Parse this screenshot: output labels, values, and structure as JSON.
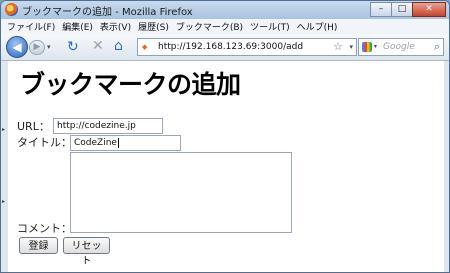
{
  "window": {
    "title": "ブックマークの追加 - Mozilla Firefox",
    "controls": {
      "minimize": "–",
      "maximize": "□",
      "close": "✕"
    }
  },
  "menubar": {
    "items": [
      "ファイル(F)",
      "編集(E)",
      "表示(V)",
      "履歴(S)",
      "ブックマーク(B)",
      "ツール(T)",
      "ヘルプ(H)"
    ]
  },
  "navbar": {
    "back_glyph": "◀",
    "forward_glyph": "▶",
    "dropdown_glyph": "▾",
    "reload_glyph": "↻",
    "stop_glyph": "✕",
    "home_glyph": "⌂",
    "url": "http://192.168.123.69:3000/add",
    "star_glyph": "☆",
    "search_placeholder": "Google",
    "search_glyph": "⌕"
  },
  "page": {
    "title": "ブックマークの追加",
    "url_label": "URL：",
    "url_value": "http://codezine.jp",
    "title_label": "タイトル：",
    "title_value": "CodeZine",
    "comment_label": "コメント：",
    "submit_label": "登録",
    "reset_label": "リセット"
  },
  "icons": {
    "app": "firefox-icon",
    "site": "site-favicon",
    "search_engine": "google-icon"
  },
  "colors": {
    "titlebar": "#a9c3e0",
    "accent": "#2c62b6"
  }
}
